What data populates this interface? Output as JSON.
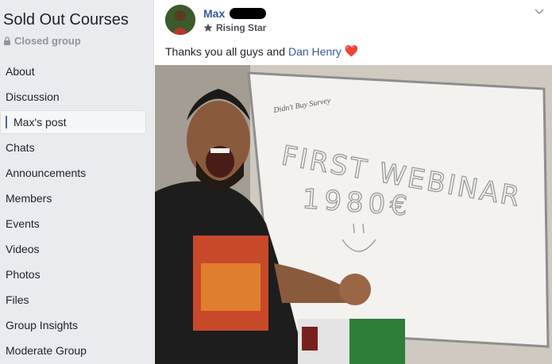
{
  "group": {
    "title": "Sold Out Courses",
    "privacy": "Closed group"
  },
  "nav": {
    "items": [
      {
        "label": "About"
      },
      {
        "label": "Discussion"
      },
      {
        "label": "Max's post"
      },
      {
        "label": "Chats"
      },
      {
        "label": "Announcements"
      },
      {
        "label": "Members"
      },
      {
        "label": "Events"
      },
      {
        "label": "Videos"
      },
      {
        "label": "Photos"
      },
      {
        "label": "Files"
      },
      {
        "label": "Group Insights"
      },
      {
        "label": "Moderate Group"
      }
    ],
    "active_index": 2
  },
  "post": {
    "author": "Max",
    "badge": "Rising Star",
    "text": "Thanks you all guys and",
    "mention": "Dan Henry",
    "emoji": "❤️",
    "photo": {
      "whiteboard_line1": "Didn't Buy Survey",
      "whiteboard_line2": "FIRST WEBINAR",
      "whiteboard_line3": "1980€"
    }
  },
  "colors": {
    "link": "#365899",
    "sidebar_bg": "#e9ebee",
    "active_marker": "#4267b2"
  }
}
